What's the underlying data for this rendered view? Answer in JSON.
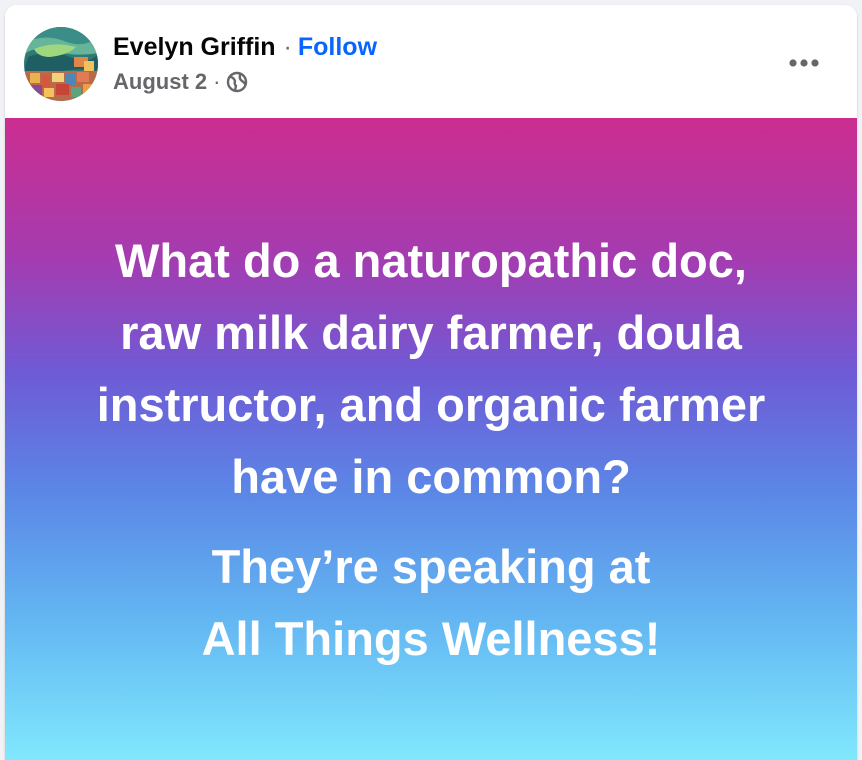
{
  "post": {
    "author": {
      "name": "Evelyn Griffin",
      "separator": "·",
      "follow_label": "Follow"
    },
    "meta": {
      "date": "August 2",
      "separator": "·",
      "audience_icon": "globe-icon"
    },
    "menu_icon": "more-horizontal-icon",
    "content": {
      "question_lines": [
        "What do a naturopathic doc,",
        "raw milk dairy farmer, doula",
        "instructor, and organic farmer",
        "have in common?"
      ],
      "answer_lines": [
        "They’re speaking at",
        "All Things Wellness!"
      ]
    },
    "colors": {
      "accent": "#0866ff",
      "gradient": [
        "#cc2d8f",
        "#a43cb1",
        "#6e5bd6",
        "#5b86e6",
        "#63b6f2",
        "#80e8fd"
      ],
      "text_on_background": "#ffffff"
    }
  }
}
